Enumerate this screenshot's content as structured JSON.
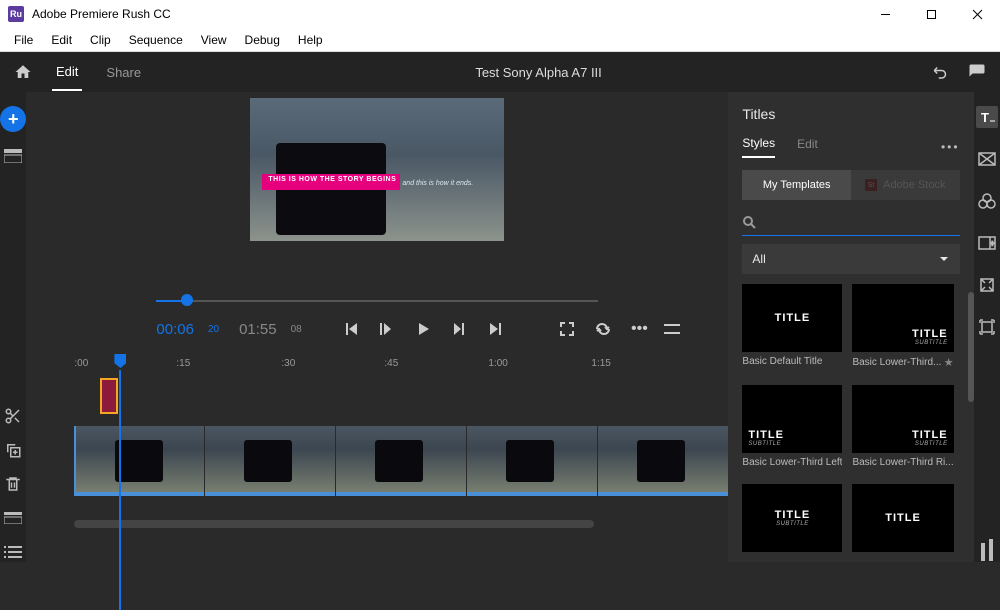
{
  "window": {
    "title": "Adobe Premiere Rush CC",
    "app_badge": "Ru"
  },
  "menubar": [
    "File",
    "Edit",
    "Clip",
    "Sequence",
    "View",
    "Debug",
    "Help"
  ],
  "topbar": {
    "tabs": {
      "edit": "Edit",
      "share": "Share"
    },
    "project_title": "Test Sony Alpha A7 III"
  },
  "preview": {
    "lower_third": "THIS IS HOW THE STORY BEGINS",
    "lower_third_sub": "and this is how it ends."
  },
  "playback": {
    "current": "00:06",
    "current_frames": "20",
    "total": "01:55",
    "total_frames": "08"
  },
  "ruler": [
    ":00",
    ":15",
    ":30",
    ":45",
    "1:00",
    "1:15"
  ],
  "titles_panel": {
    "heading": "Titles",
    "tabs": {
      "styles": "Styles",
      "edit": "Edit"
    },
    "source": {
      "mine": "My Templates",
      "stock": "Adobe Stock"
    },
    "filter": "All",
    "templates": [
      {
        "thumb_title": "TITLE",
        "thumb_sub": "",
        "label": "Basic Default Title",
        "pos": "center"
      },
      {
        "thumb_title": "TITLE",
        "thumb_sub": "SUBTITLE",
        "label": "Basic Lower-Third...",
        "pos": "lr",
        "star": true
      },
      {
        "thumb_title": "TITLE",
        "thumb_sub": "SUBTITLE",
        "label": "Basic Lower-Third Left",
        "pos": "ll"
      },
      {
        "thumb_title": "TITLE",
        "thumb_sub": "SUBTITLE",
        "label": "Basic Lower-Third Ri...",
        "pos": "lr"
      },
      {
        "thumb_title": "TITLE",
        "thumb_sub": "SUBTITLE",
        "label": "",
        "pos": "center"
      },
      {
        "thumb_title": "TITLE",
        "thumb_sub": "",
        "label": "",
        "pos": "center"
      }
    ]
  }
}
